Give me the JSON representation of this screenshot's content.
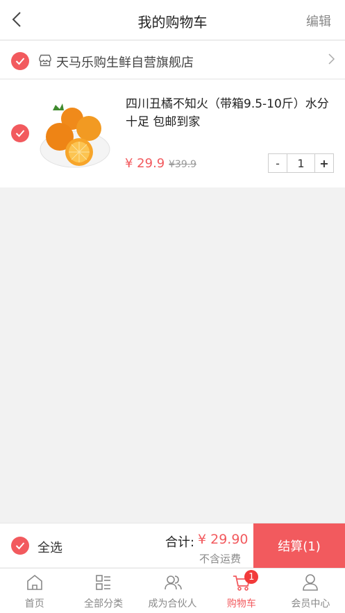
{
  "header": {
    "title": "我的购物车",
    "edit_label": "编辑"
  },
  "shop": {
    "name": "天马乐购生鲜自营旗舰店",
    "selected": true
  },
  "items": [
    {
      "title": "四川丑橘不知火（带箱9.5-10斤）水分十足 包邮到家",
      "price": "¥ 29.9",
      "original_price": "¥39.9",
      "quantity": "1",
      "minus_label": "-",
      "plus_label": "+",
      "selected": true
    }
  ],
  "checkout": {
    "select_all_label": "全选",
    "total_label": "合计:",
    "total_value": "¥ 29.90",
    "shipping_note": "不含运费",
    "button_label": "结算(1)"
  },
  "tabbar": {
    "tabs": [
      {
        "label": "首页",
        "icon": "home-icon"
      },
      {
        "label": "全部分类",
        "icon": "category-icon"
      },
      {
        "label": "成为合伙人",
        "icon": "partner-icon"
      },
      {
        "label": "购物车",
        "icon": "cart-icon",
        "badge": "1",
        "active": true
      },
      {
        "label": "会员中心",
        "icon": "user-icon"
      }
    ]
  },
  "colors": {
    "accent": "#f25a5e",
    "muted": "#888888",
    "background": "#f2f2f2"
  }
}
